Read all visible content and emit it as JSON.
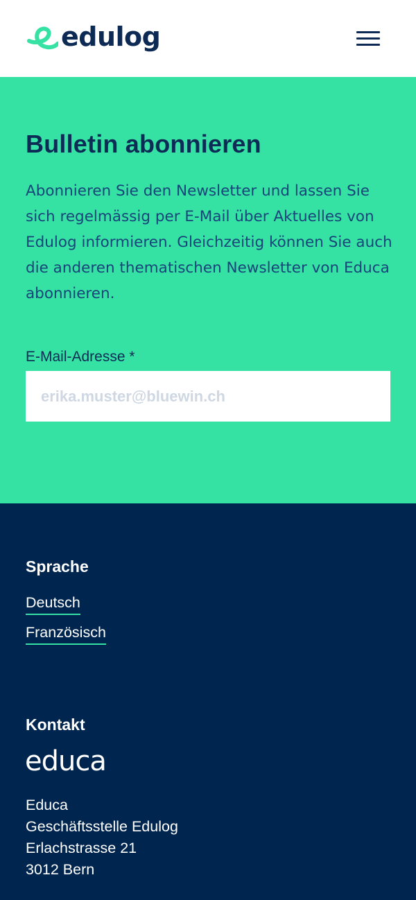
{
  "header": {
    "logo_text": "edulog",
    "menu_label": "Menu"
  },
  "newsletter": {
    "title": "Bulletin abonnieren",
    "description": "Abonnieren Sie den Newsletter und lassen Sie sich regelmässig per E-Mail über Aktuel­les von Edulog informieren. Gleichzeitig kön­nen Sie auch die anderen thematischen Newsletter von Educa abonnieren.",
    "email_label": "E-Mail-Adresse *",
    "email_placeholder": "erika.muster@bluewin.ch",
    "email_value": ""
  },
  "footer": {
    "language_heading": "Sprache",
    "languages": [
      "Deutsch",
      "Französisch"
    ],
    "contact_heading": "Kontakt",
    "contact_logo_text": "educa",
    "address": [
      "Educa",
      "Geschäftsstelle Edulog",
      "Erlachstrasse 21",
      "3012 Bern"
    ]
  },
  "colors": {
    "brand_green": "#35e2a4",
    "brand_navy": "#00264f",
    "text_dark": "#0c2c55"
  }
}
